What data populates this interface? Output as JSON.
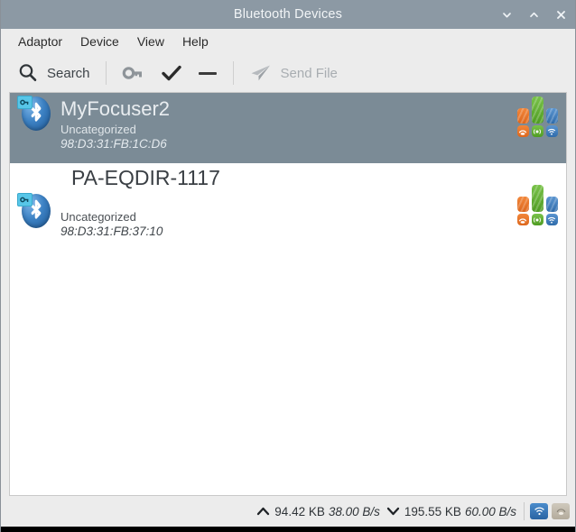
{
  "window": {
    "title": "Bluetooth Devices",
    "controls": [
      {
        "name": "minimize",
        "glyph": "chevron-down"
      },
      {
        "name": "maximize",
        "glyph": "chevron-up"
      },
      {
        "name": "close",
        "glyph": "x"
      }
    ]
  },
  "menu": {
    "items": [
      {
        "label": "Adaptor"
      },
      {
        "label": "Device"
      },
      {
        "label": "View"
      },
      {
        "label": "Help"
      }
    ]
  },
  "toolbar": {
    "search_label": "Search",
    "search_icon": "search-icon",
    "key_icon": "key-icon",
    "check_icon": "check-icon",
    "dash_icon": "minus-icon",
    "send_file_label": "Send File",
    "send_file_icon": "paper-plane-icon",
    "send_file_enabled": false
  },
  "devices": [
    {
      "name": "MyFocuser2",
      "category": "Uncategorized",
      "address": "98:D3:31:FB:1C:D6",
      "selected": true,
      "icon": "bluetooth-paired-icon",
      "badges": {
        "bars": [
          {
            "color": "#e8762b",
            "level": "low"
          },
          {
            "color": "#5aa82a",
            "level": "high"
          },
          {
            "color": "#3a78b8",
            "level": "low"
          }
        ],
        "services": [
          {
            "name": "audio-service-icon",
            "color": "#e8762b"
          },
          {
            "name": "network-service-icon",
            "color": "#5aa82a"
          },
          {
            "name": "wifi-service-icon",
            "color": "#3a78b8"
          }
        ]
      }
    },
    {
      "name": "PA-EQDIR-1117",
      "category": "Uncategorized",
      "address": "98:D3:31:FB:37:10",
      "selected": false,
      "icon": "bluetooth-paired-icon",
      "badges": {
        "bars": [
          {
            "color": "#e8762b",
            "level": "low"
          },
          {
            "color": "#5aa82a",
            "level": "high"
          },
          {
            "color": "#3a78b8",
            "level": "low"
          }
        ],
        "services": [
          {
            "name": "audio-service-icon",
            "color": "#e8762b"
          },
          {
            "name": "network-service-icon",
            "color": "#5aa82a"
          },
          {
            "name": "wifi-service-icon",
            "color": "#3a78b8"
          }
        ]
      }
    }
  ],
  "statusbar": {
    "upload_arrow": "up-arrow-icon",
    "upload_total": "94.42 KB",
    "upload_rate": "38.00 B/s",
    "download_arrow": "down-arrow-icon",
    "download_total": "195.55 KB",
    "download_rate": "60.00 B/s",
    "tray": [
      {
        "name": "bluetooth-active-tray-icon",
        "state": "active"
      },
      {
        "name": "bluetooth-idle-tray-icon",
        "state": "idle"
      }
    ]
  },
  "colors": {
    "titlebar": "#8c99a4",
    "chrome": "#ececec",
    "selection": "#7b8b96",
    "list_bg": "#ffffff",
    "accent_orange": "#e8762b",
    "accent_green": "#5aa82a",
    "accent_blue": "#3a78b8"
  }
}
